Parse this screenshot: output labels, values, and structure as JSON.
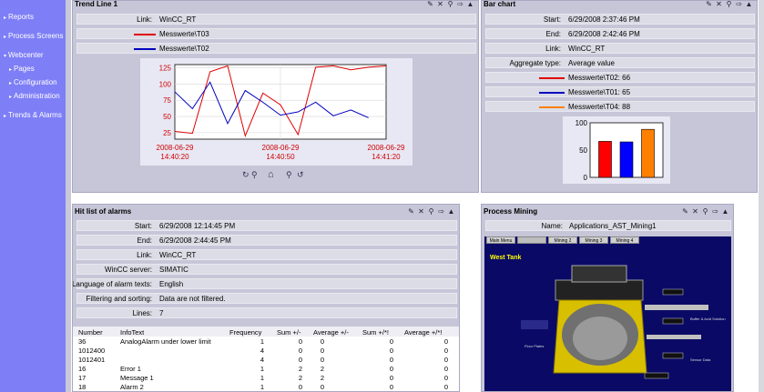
{
  "nav": {
    "items": [
      {
        "label": "Reports",
        "top": 14
      },
      {
        "label": "Process Screens",
        "top": 35
      },
      {
        "label": "Webcenter",
        "top": 56
      },
      {
        "label": "Pages",
        "top": 71,
        "sub": true,
        "selected": true
      },
      {
        "label": "Configuration",
        "top": 86,
        "sub": true
      },
      {
        "label": "Administration",
        "top": 101,
        "sub": true
      },
      {
        "label": "Trends & Alarms",
        "top": 122
      }
    ]
  },
  "trend": {
    "title": "Trend Line 1",
    "link_label": "Link:",
    "link_value": "WinCC_RT",
    "series": [
      {
        "name": "Messwerte\\T03",
        "color": "#e00000"
      },
      {
        "name": "Messwerte\\T02",
        "color": "#0000c0"
      }
    ]
  },
  "chart_data": [
    {
      "type": "line",
      "x": [
        "14:40:20",
        "14:40:25",
        "14:40:30",
        "14:40:35",
        "14:40:40",
        "14:40:45",
        "14:40:50",
        "14:40:55",
        "14:41:00",
        "14:41:05",
        "14:41:10",
        "14:41:15",
        "14:41:20"
      ],
      "series": [
        {
          "name": "Messwerte\\T03",
          "values": [
            27,
            24,
            119,
            128,
            20,
            86,
            68,
            22,
            126,
            128,
            122,
            126,
            128
          ]
        },
        {
          "name": "Messwerte\\T02",
          "values": [
            88,
            62,
            103,
            39,
            90,
            72,
            52,
            57,
            72,
            51,
            60,
            48
          ]
        }
      ],
      "x_tick_labels": [
        {
          "date": "2008-06-29",
          "time": "14:40:20"
        },
        {
          "date": "2008-06-29",
          "time": "14:40:50"
        },
        {
          "date": "2008-06-29",
          "time": "14:41:20"
        }
      ],
      "y_ticks": [
        125,
        100,
        75,
        50,
        25
      ],
      "ylim": [
        15,
        130
      ]
    },
    {
      "type": "bar",
      "categories": [
        "Messwerte\\T02",
        "Messwerte\\T01",
        "Messwerte\\T04"
      ],
      "values": [
        66,
        65,
        88
      ],
      "colors": [
        "#ff0000",
        "#0000ff",
        "#ff8000"
      ],
      "y_ticks": [
        100,
        50,
        0
      ],
      "ylim": [
        0,
        100
      ]
    }
  ],
  "bar": {
    "title": "Bar chart",
    "rows": [
      {
        "label": "Start:",
        "value": "6/29/2008 2:37:46 PM"
      },
      {
        "label": "End:",
        "value": "6/29/2008 2:42:46 PM"
      },
      {
        "label": "Link:",
        "value": "WinCC_RT"
      },
      {
        "label": "Aggregate type:",
        "value": "Average value"
      }
    ],
    "legend": [
      {
        "name": "Messwerte\\T02: 66",
        "color": "#e00000"
      },
      {
        "name": "Messwerte\\T01: 65",
        "color": "#0000c0"
      },
      {
        "name": "Messwerte\\T04: 88",
        "color": "#ff8000"
      }
    ]
  },
  "alarms": {
    "title": "Hit list of alarms",
    "rows": [
      {
        "label": "Start:",
        "value": "6/29/2008 12:14:45 PM"
      },
      {
        "label": "End:",
        "value": "6/29/2008 2:44:45 PM"
      },
      {
        "label": "Link:",
        "value": "WinCC_RT"
      },
      {
        "label": "WinCC server:",
        "value": "SIMATIC"
      },
      {
        "label": "Language of alarm texts:",
        "value": "English"
      },
      {
        "label": "Filtering and sorting:",
        "value": "Data are not filtered."
      },
      {
        "label": "Lines:",
        "value": "7"
      }
    ],
    "columns": [
      "Number",
      "InfoText",
      "Frequency",
      "Sum +/-",
      "Average +/-",
      "Sum +/*!",
      "Average +/*!"
    ],
    "table": [
      [
        "36",
        "AnalogAlarm under lower limit",
        "1",
        "0",
        "0",
        "0",
        "0"
      ],
      [
        "1012400",
        "",
        "4",
        "0",
        "0",
        "0",
        "0"
      ],
      [
        "1012401",
        "",
        "4",
        "0",
        "0",
        "0",
        "0"
      ],
      [
        "16",
        "Error 1",
        "1",
        "2",
        "2",
        "0",
        "0"
      ],
      [
        "17",
        "Message 1",
        "1",
        "2",
        "2",
        "0",
        "0"
      ],
      [
        "18",
        "Alarm 2",
        "1",
        "0",
        "0",
        "0",
        "0"
      ]
    ]
  },
  "mining": {
    "title": "Process Mining",
    "name_label": "Name:",
    "name_value": "Applications_AST_Mining1",
    "tabs": [
      "Main Menu",
      "Mining 1",
      "Mining 2",
      "Mining 3",
      "Mining 4"
    ],
    "tank_label": "West Tank",
    "small_labels": [
      "Floor Plates",
      "Buffer & Acid Solution",
      "Sensor Data"
    ]
  },
  "icons": [
    "edit-icon",
    "close-icon",
    "properties-icon",
    "export-icon",
    "collapse-icon"
  ],
  "colors": {
    "nav_bg": "#7e7ef7",
    "panel_bg": "#c6c6d8",
    "row_bg": "#dcdce6",
    "chart_bg": "#e8e8f4"
  }
}
